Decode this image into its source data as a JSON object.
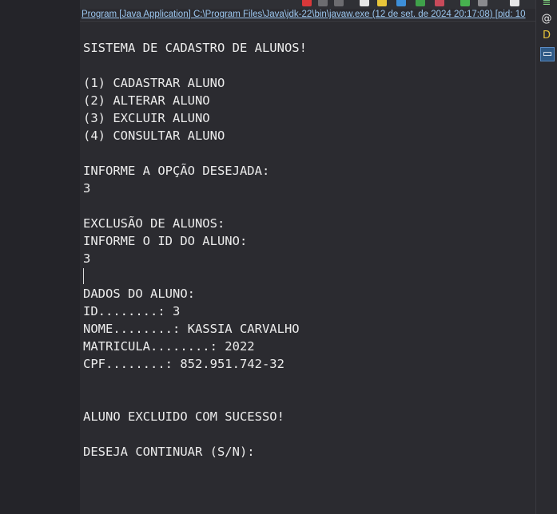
{
  "console_title": "Program [Java Application] C:\\Program Files\\Java\\jdk-22\\bin\\javaw.exe  (12 de set. de 2024 20:17:08) [pid: 10",
  "toolbar": {
    "icons": [
      "terminate-icon",
      "remove-launch-icon",
      "remove-all-icon",
      "scroll-lock-icon",
      "pin-console-icon",
      "word-wrap-icon",
      "display-console-icon",
      "new-console-icon",
      "open-console-icon"
    ]
  },
  "side_panel": {
    "icons": [
      "tasks-icon",
      "javadoc-icon",
      "declaration-icon",
      "console-icon"
    ],
    "glyphs": [
      "≡",
      "@",
      "D",
      "▭"
    ]
  },
  "console_lines": [
    "SISTEMA DE CADASTRO DE ALUNOS!",
    "",
    "(1) CADASTRAR ALUNO",
    "(2) ALTERAR ALUNO",
    "(3) EXCLUIR ALUNO",
    "(4) CONSULTAR ALUNO",
    "",
    "INFORME A OPÇÃO DESEJADA:",
    "3",
    "",
    "EXCLUSÃO DE ALUNOS:",
    "INFORME O ID DO ALUNO:",
    "3",
    "",
    "DADOS DO ALUNO:",
    "ID........: 3",
    "NOME........: KASSIA CARVALHO",
    "MATRICULA........: 2022",
    "CPF........: 852.951.742-32",
    "",
    "",
    "ALUNO EXCLUIDO COM SUCESSO!",
    "",
    "DESEJA CONTINUAR (S/N):"
  ],
  "colors": {
    "background": "#2b2b30",
    "text": "#ececec",
    "link": "#9cc7f0",
    "active_icon": "#2f5a86"
  }
}
